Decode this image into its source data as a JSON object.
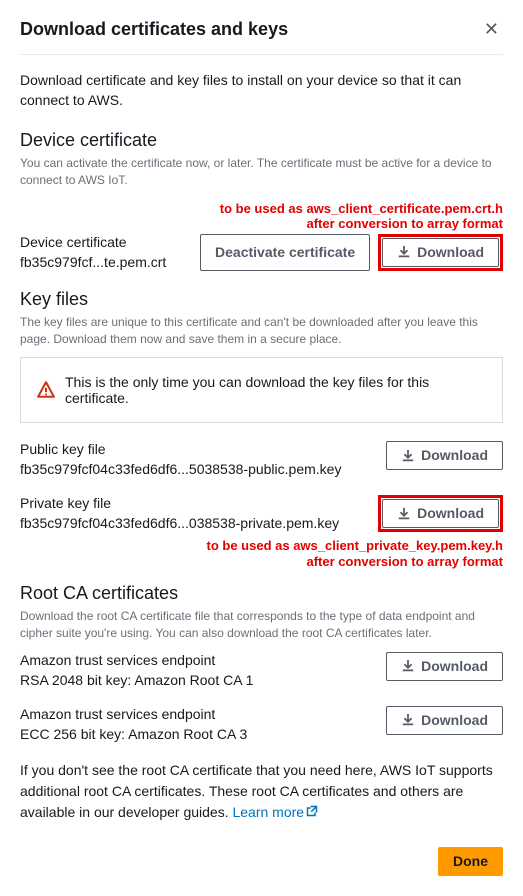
{
  "header": {
    "title": "Download certificates and keys"
  },
  "intro": "Download certificate and key files to install on your device so that it can connect to AWS.",
  "deviceCert": {
    "heading": "Device certificate",
    "desc": "You can activate the certificate now, or later. The certificate must be active for a device to connect to AWS IoT.",
    "annotation": "to be used as aws_client_certificate.pem.crt.h\nafter conversion to array format",
    "label": "Device certificate",
    "value": "fb35c979fcf...te.pem.crt",
    "deactivateLabel": "Deactivate certificate",
    "downloadLabel": "Download"
  },
  "keyFiles": {
    "heading": "Key files",
    "desc": "The key files are unique to this certificate and can't be downloaded after you leave this page. Download them now and save them in a secure place.",
    "alert": "This is the only time you can download the key files for this certificate.",
    "publicLabel": "Public key file",
    "publicValue": "fb35c979fcf04c33fed6df6...5038538-public.pem.key",
    "privateLabel": "Private key file",
    "privateValue": "fb35c979fcf04c33fed6df6...038538-private.pem.key",
    "downloadLabel": "Download",
    "annotation": "to be used as aws_client_private_key.pem.key.h\nafter conversion to array format"
  },
  "rootCA": {
    "heading": "Root CA certificates",
    "desc": "Download the root CA certificate file that corresponds to the type of data endpoint and cipher suite you're using. You can also download the root CA certificates later.",
    "ep1Label": "Amazon trust services endpoint",
    "ep1Value": "RSA 2048 bit key: Amazon Root CA 1",
    "ep2Label": "Amazon trust services endpoint",
    "ep2Value": "ECC 256 bit key: Amazon Root CA 3",
    "downloadLabel": "Download"
  },
  "footnote": {
    "text": "If you don't see the root CA certificate that you need here, AWS IoT supports additional root CA certificates. These root CA certificates and others are available in our developer guides. ",
    "linkLabel": "Learn more"
  },
  "footer": {
    "doneLabel": "Done"
  }
}
